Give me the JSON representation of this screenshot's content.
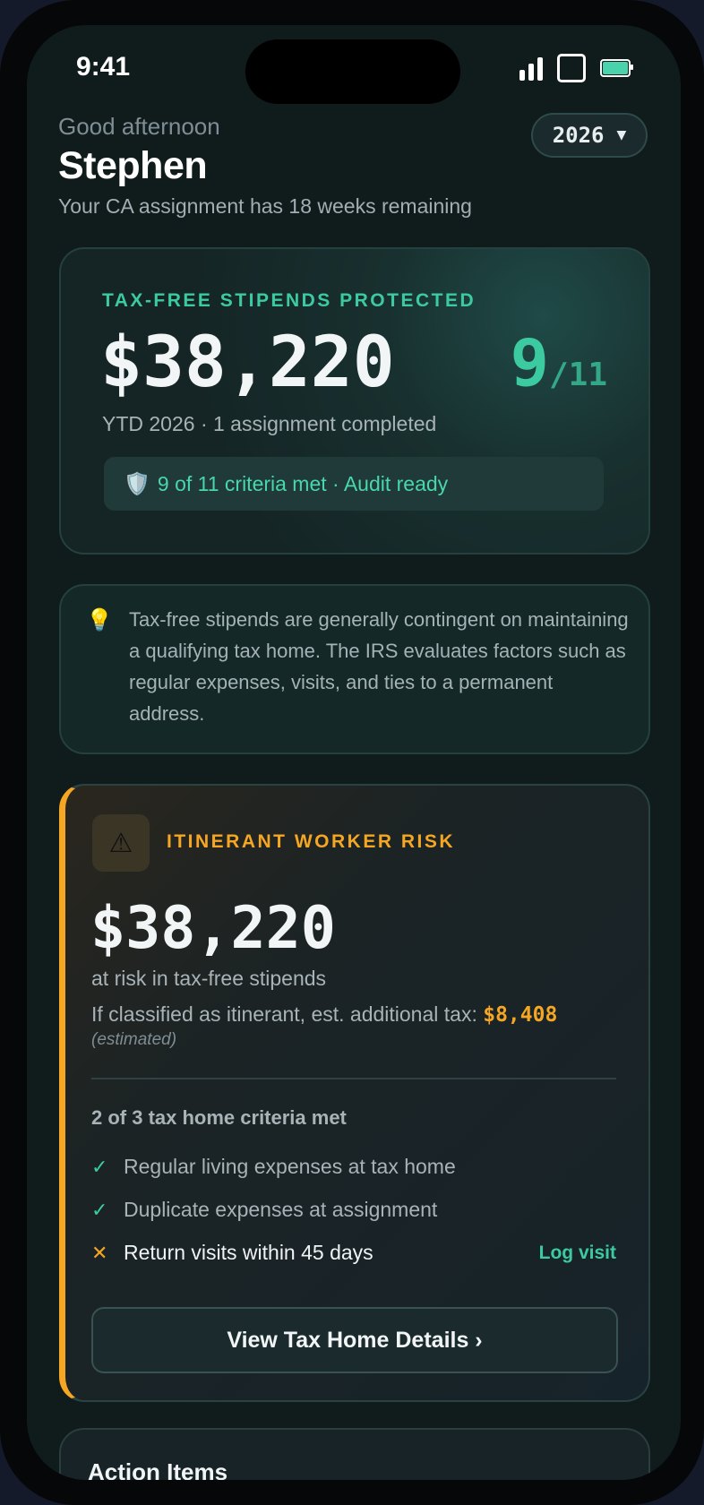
{
  "status_bar": {
    "time": "9:41"
  },
  "header": {
    "greeting": "Good afternoon",
    "name": "Stephen",
    "subtitle": "Your CA assignment has 18 weeks remaining",
    "year_selector": "2026",
    "year_caret": "▼"
  },
  "protected_card": {
    "label": "TAX-FREE STIPENDS PROTECTED",
    "amount": "$38,220",
    "score": "9",
    "score_total": "/11",
    "subtitle": "YTD 2026 · 1 assignment completed",
    "audit_icon": "🛡️",
    "audit_text": "9 of 11 criteria met · Audit ready"
  },
  "info_card": {
    "icon": "💡",
    "text": "Tax-free stipends are generally contingent on maintaining a qualifying tax home. The IRS evaluates factors such as regular expenses, visits, and ties to a permanent address."
  },
  "risk_card": {
    "warning_icon": "⚠",
    "label": "ITINERANT WORKER RISK",
    "amount": "$38,220",
    "subtitle": "at risk in tax-free stipends",
    "tax_prefix": "If classified as itinerant, est. additional tax: ",
    "tax_amount": "$8,408",
    "estimated_note": "(estimated)",
    "criteria_heading": "2 of 3 tax home criteria met",
    "criteria": [
      {
        "mark": "✓",
        "label": "Regular living expenses at tax home",
        "met": true
      },
      {
        "mark": "✓",
        "label": "Duplicate expenses at assignment",
        "met": true
      },
      {
        "mark": "✕",
        "label": "Return visits within 45 days",
        "met": false,
        "action": "Log visit"
      }
    ],
    "details_button": "View Tax Home Details ›"
  },
  "action_items": {
    "title": "Action Items"
  },
  "colors": {
    "accent_green": "#3ccba1",
    "warning_orange": "#f5a623",
    "background": "#101b1c"
  }
}
